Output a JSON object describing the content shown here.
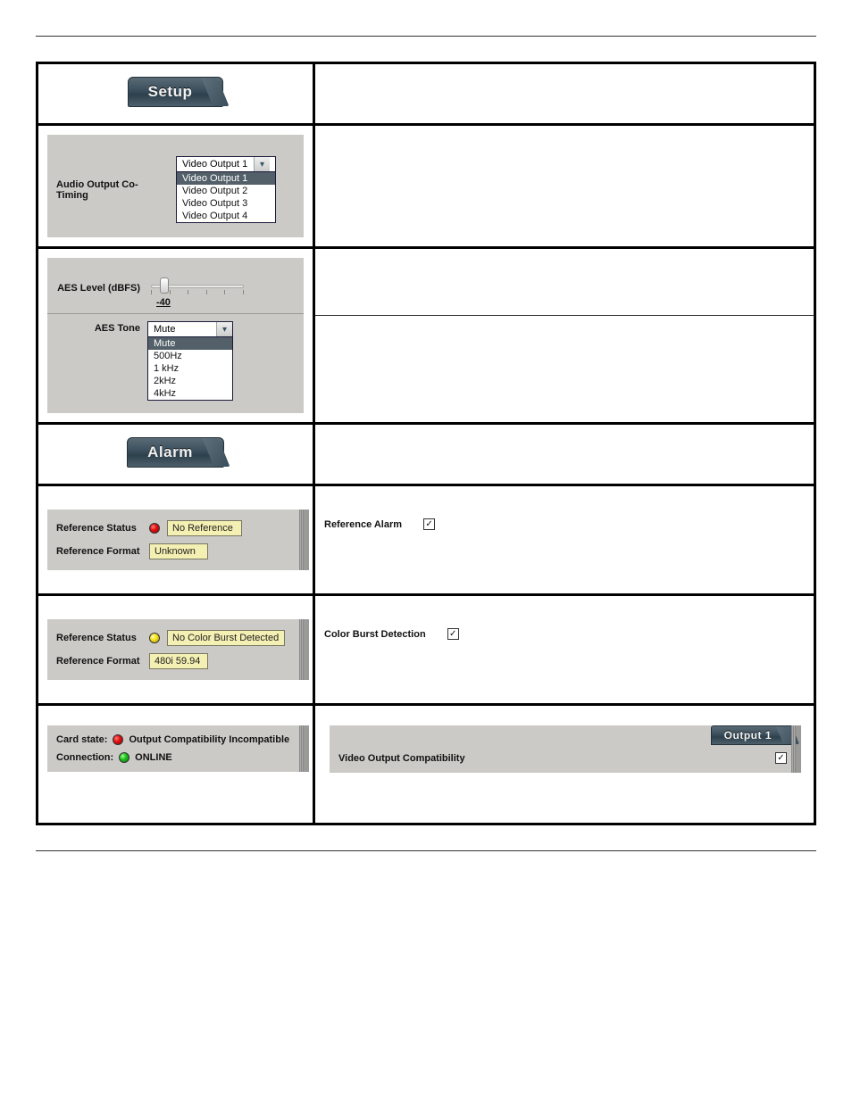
{
  "setup": {
    "tab_label": "Setup",
    "audio_cotiming": {
      "label": "Audio Output Co-Timing",
      "selected": "Video Output 1",
      "options": [
        "Video Output 1",
        "Video Output 2",
        "Video Output 3",
        "Video Output 4"
      ]
    },
    "aes_level": {
      "label": "AES Level (dBFS)",
      "value": "-40"
    },
    "aes_tone": {
      "label": "AES Tone",
      "selected": "Mute",
      "options": [
        "Mute",
        "500Hz",
        "1 kHz",
        "2kHz",
        "4kHz"
      ]
    }
  },
  "alarm": {
    "tab_label": "Alarm",
    "ref1": {
      "status_label": "Reference Status",
      "status_value": "No Reference",
      "status_color": "red",
      "format_label": "Reference Format",
      "format_value": "Unknown",
      "alarm_label": "Reference Alarm",
      "alarm_checked": true
    },
    "ref2": {
      "status_label": "Reference Status",
      "status_value": "No Color Burst Detected",
      "status_color": "yellow",
      "format_label": "Reference Format",
      "format_value": "480i 59.94",
      "alarm_label": "Color Burst Detection",
      "alarm_checked": true
    },
    "card": {
      "state_label": "Card state:",
      "state_value": "Output Compatibility Incompatible",
      "state_color": "red",
      "conn_label": "Connection:",
      "conn_value": "ONLINE",
      "conn_color": "green",
      "output_tab": "Output 1",
      "compat_label": "Video Output Compatibility",
      "compat_checked": true
    }
  }
}
